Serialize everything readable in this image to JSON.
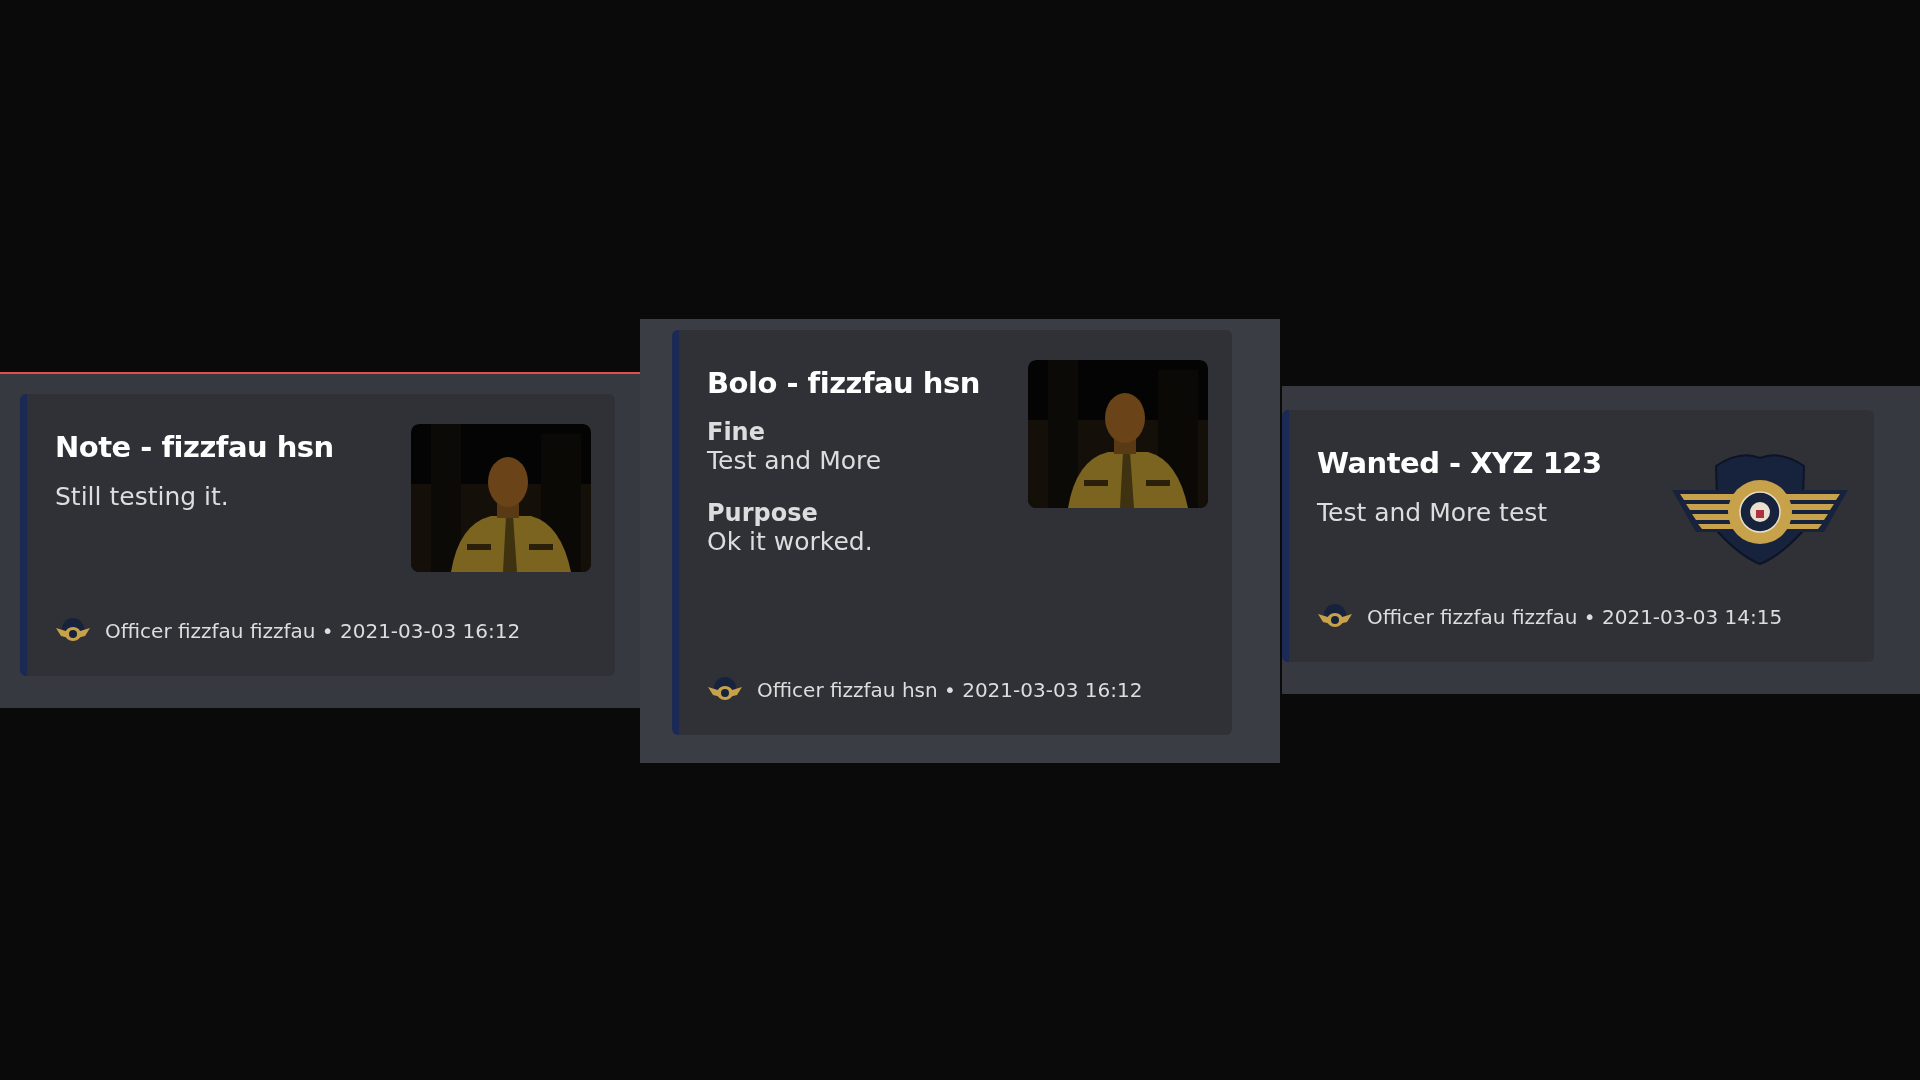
{
  "embeds": [
    {
      "title": "Note - fizzfau hsn",
      "description": "Still testing it.",
      "thumbnail": {
        "kind": "picture"
      },
      "footer": "Officer fizzfau fizzfau • 2021-03-03 16:12"
    },
    {
      "title": "Bolo - fizzfau hsn",
      "fields": [
        {
          "name": "Fine",
          "value": "Test and More"
        },
        {
          "name": "Purpose",
          "value": "Ok it worked."
        }
      ],
      "thumbnail": {
        "kind": "picture"
      },
      "footer": "Officer fizzfau hsn • 2021-03-03 16:12"
    },
    {
      "title": "Wanted - XYZ 123",
      "description": "Test and More test",
      "thumbnail": {
        "kind": "emblem"
      },
      "footer": "Officer fizzfau fizzfau • 2021-03-03 14:15"
    }
  ]
}
